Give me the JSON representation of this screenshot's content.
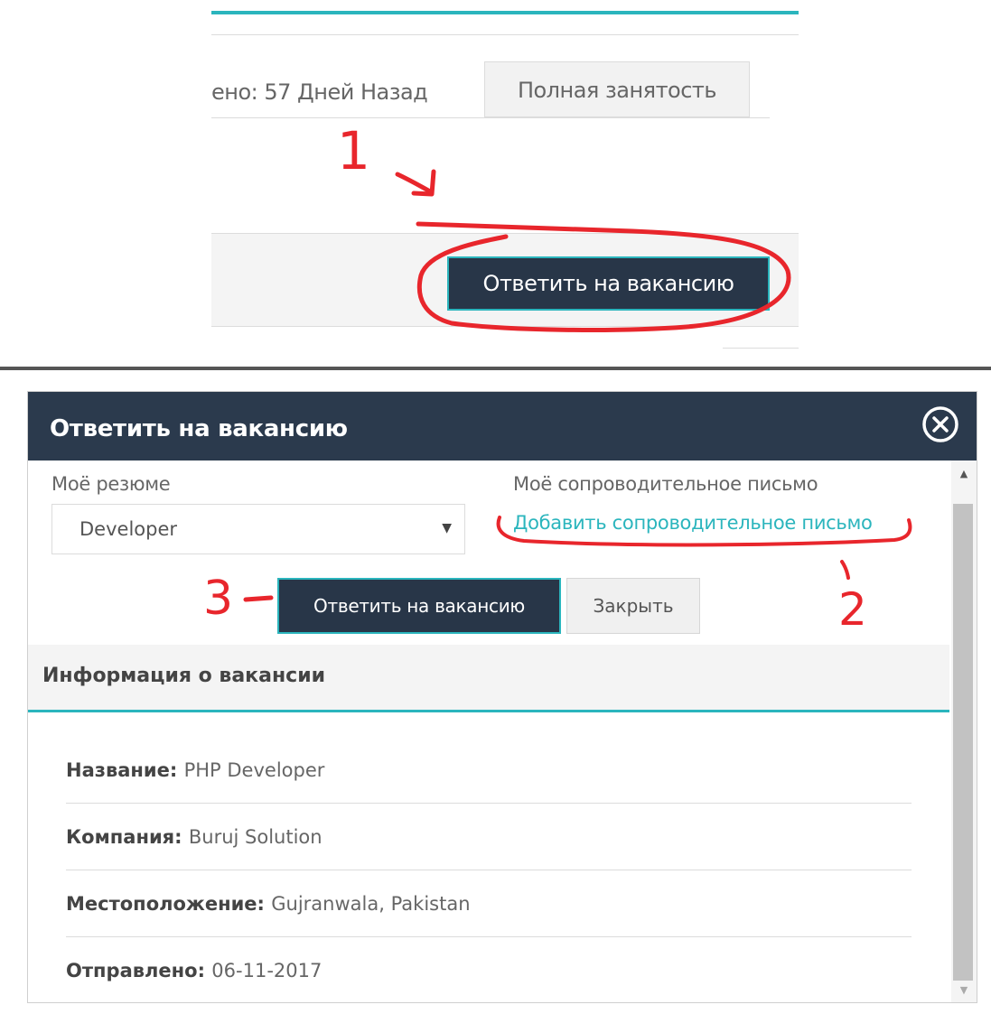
{
  "listing": {
    "posted_text": "ено: 57 Дней Назад",
    "job_type": "Полная занятость",
    "apply_label": "Ответить на вакансию"
  },
  "modal": {
    "title": "Ответить на вакансию",
    "resume_label": "Моё резюме",
    "resume_selected": "Developer",
    "cover_label": "Моё сопроводительное письмо",
    "cover_link": "Добавить сопроводительное письмо",
    "apply_label": "Ответить на вакансию",
    "close_label": "Закрыть",
    "info_title": "Информация о вакансии",
    "info_rows": [
      {
        "label": "Название:",
        "value": "PHP Developer"
      },
      {
        "label": "Компания:",
        "value": "Buruj Solution"
      },
      {
        "label": "Местоположение:",
        "value": "Gujranwala, Pakistan"
      },
      {
        "label": "Отправлено:",
        "value": "06-11-2017"
      }
    ]
  },
  "annotations": {
    "marks": [
      "1",
      "2",
      "3"
    ],
    "color": "#e8262c"
  },
  "colors": {
    "accent": "#2bb5bd",
    "header_dark": "#2b3a4d",
    "button_dark": "#283648"
  }
}
